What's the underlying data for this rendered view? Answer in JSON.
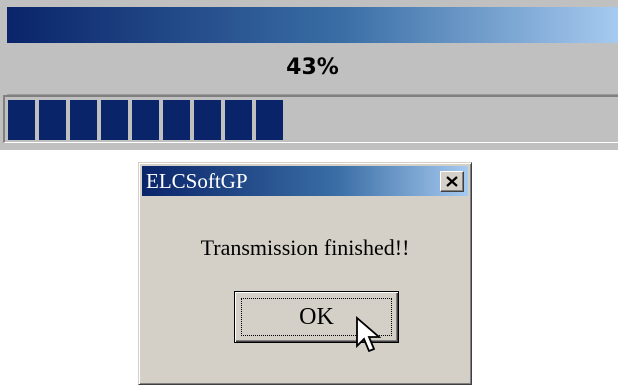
{
  "progress": {
    "percent_text": "43%",
    "value": 0.43,
    "filled_blocks": 9,
    "colors": {
      "fill": "#0a246a",
      "background": "#c0c0c0"
    }
  },
  "dialog": {
    "title": "ELCSoftGP",
    "message": "Transmission finished!!",
    "ok_label": "OK",
    "close_icon": "close-icon",
    "colors": {
      "titlebar": "#0a246a",
      "face": "#d4d0c8"
    }
  },
  "cursor": {
    "icon": "arrow-cursor-icon"
  }
}
